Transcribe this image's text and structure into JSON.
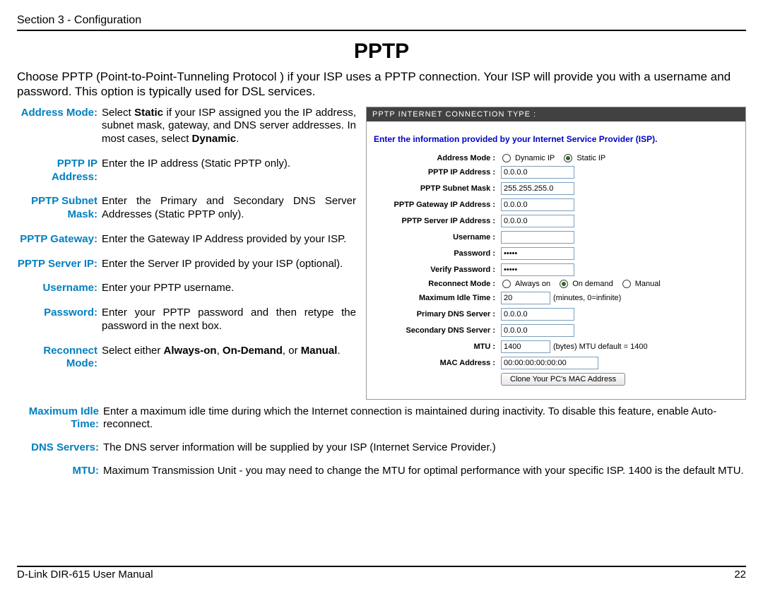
{
  "header": "Section 3 - Configuration",
  "title": "PPTP",
  "intro": "Choose PPTP (Point-to-Point-Tunneling Protocol ) if your ISP uses a PPTP connection. Your ISP will provide you with a username and password. This option is typically used for DSL services.",
  "defs": {
    "address_mode": {
      "label": "Address Mode:"
    },
    "pptp_ip": {
      "label": "PPTP IP Address:",
      "desc": "Enter the IP address (Static PPTP only)."
    },
    "subnet": {
      "label": "PPTP Subnet Mask:",
      "desc": "Enter the Primary and Secondary DNS Server Addresses (Static PPTP only)."
    },
    "gateway": {
      "label": "PPTP Gateway:",
      "desc": "Enter the Gateway IP Address provided by your ISP."
    },
    "server_ip": {
      "label": "PPTP Server IP:",
      "desc": "Enter the Server IP provided by your ISP (optional)."
    },
    "username": {
      "label": "Username:",
      "desc": "Enter your PPTP username."
    },
    "password": {
      "label": "Password:",
      "desc": "Enter your PPTP password and then retype the password in the next box."
    },
    "reconnect": {
      "label": "Reconnect Mode:"
    },
    "max_idle": {
      "label": "Maximum Idle Time:",
      "desc": "Enter a maximum idle time during which the Internet connection is maintained during inactivity. To disable this feature, enable Auto-reconnect."
    },
    "dns": {
      "label": "DNS Servers:",
      "desc": "The DNS server information will be supplied by your ISP (Internet Service Provider.)"
    },
    "mtu": {
      "label": "MTU:",
      "desc": "Maximum Transmission Unit - you may need to change the MTU for optimal performance with your specific ISP. 1400 is the default MTU."
    }
  },
  "router": {
    "titlebar": "PPTP INTERNET CONNECTION TYPE :",
    "instruction": "Enter the information provided by your Internet Service Provider (ISP).",
    "labels": {
      "address_mode": "Address Mode :",
      "ip": "PPTP IP Address :",
      "subnet": "PPTP Subnet Mask :",
      "gateway": "PPTP Gateway IP Address :",
      "server": "PPTP Server IP Address :",
      "username": "Username :",
      "password": "Password :",
      "verify": "Verify Password :",
      "reconnect": "Reconnect Mode :",
      "maxidle": "Maximum Idle Time :",
      "pdns": "Primary DNS Server :",
      "sdns": "Secondary DNS Server :",
      "mtu": "MTU :",
      "mac": "MAC Address :"
    },
    "radios": {
      "dynamic": "Dynamic IP",
      "static": "Static IP",
      "always": "Always on",
      "ondemand": "On demand",
      "manual": "Manual"
    },
    "values": {
      "ip": "0.0.0.0",
      "subnet": "255.255.255.0",
      "gateway": "0.0.0.0",
      "server": "0.0.0.0",
      "username": "",
      "password": "•••••",
      "verify": "•••••",
      "maxidle": "20",
      "pdns": "0.0.0.0",
      "sdns": "0.0.0.0",
      "mtu": "1400",
      "mac": "00:00:00:00:00:00"
    },
    "suffix": {
      "maxidle": "(minutes, 0=infinite)",
      "mtu": "(bytes)   MTU default = 1400"
    },
    "button": "Clone Your PC's MAC Address"
  },
  "footer": {
    "manual": "D-Link DIR-615 User Manual",
    "page": "22"
  }
}
